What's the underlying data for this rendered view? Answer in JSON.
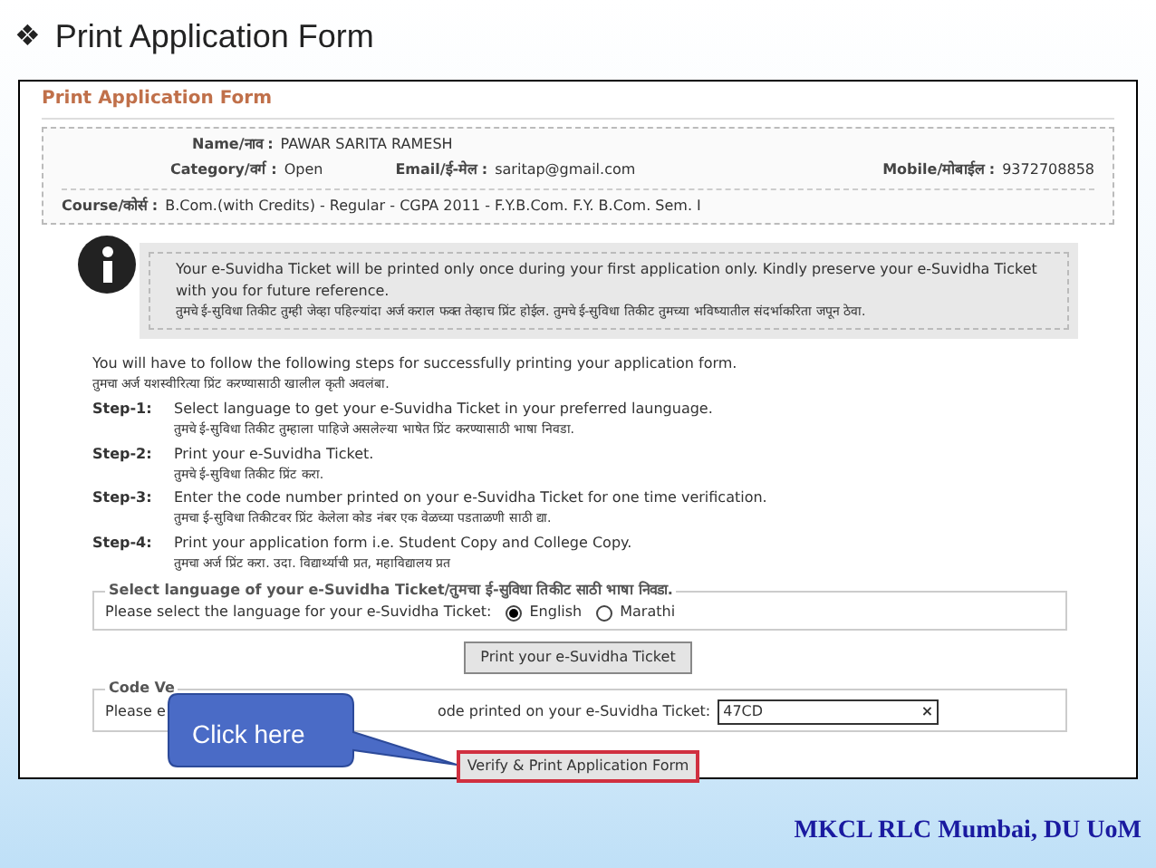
{
  "slide_title": {
    "bullet": "❖",
    "text": "Print Application Form"
  },
  "form": {
    "header": "Print Application Form",
    "user_info": {
      "name_label": "Name/नाव :",
      "name": "PAWAR SARITA RAMESH",
      "category_label": "Category/वर्ग :",
      "category": "Open",
      "email_label": "Email/ई-मेल :",
      "email": "saritap@gmail.com",
      "mobile_label": "Mobile/मोबाईल :",
      "mobile": "9372708858",
      "course_label": "Course/कोर्स :",
      "course": "B.Com.(with Credits) - Regular - CGPA 2011 - F.Y.B.Com. F.Y. B.Com. Sem. I"
    },
    "notice": {
      "english": "Your e-Suvidha Ticket will be printed only once during your first application only. Kindly preserve your e-Suvidha Ticket with you for future reference.",
      "marathi": "तुमचे ई-सुविधा तिकीट तुम्ही जेव्हा पहिल्यांदा अर्ज कराल फक्त तेव्हाच प्रिंट होईल. तुमचे ई-सुविधा तिकीट तुमच्या भविष्यातील संदर्भाकरिता जपून ठेवा."
    },
    "intro": {
      "english": "You will have to follow the following steps for successfully printing your application form.",
      "marathi": "तुमचा अर्ज यशस्वीरित्या प्रिंट करण्यासाठी खालील कृती अवलंबा."
    },
    "steps": [
      {
        "label": "Step-1:",
        "english": "Select language to get your e-Suvidha Ticket in your preferred launguage.",
        "marathi": "तुमचे ई-सुविधा तिकीट तुम्हाला पाहिजे असलेल्या भाषेत प्रिंट करण्यासाठी भाषा निवडा."
      },
      {
        "label": "Step-2:",
        "english": "Print your e-Suvidha Ticket.",
        "marathi": "तुमचे ई-सुविधा तिकीट प्रिंट करा."
      },
      {
        "label": "Step-3:",
        "english": "Enter the code number printed on your e-Suvidha Ticket for one time verification.",
        "marathi": "तुमचा ई-सुविधा तिकीटवर प्रिंट केलेला कोड नंबर एक वेळच्या पडताळणी साठी द्या."
      },
      {
        "label": "Step-4:",
        "english": "Print your application form i.e. Student Copy and College Copy.",
        "marathi": "तुमचा अर्ज प्रिंट करा. उदा. विद्यार्थ्याची प्रत, महाविद्यालय प्रत"
      }
    ],
    "language": {
      "legend": "Select language of your e-Suvidha Ticket/तुमचा ई-सुविधा तिकीट साठी भाषा निवडा.",
      "prompt": "Please select the language for your e-Suvidha Ticket:",
      "options": [
        {
          "label": "English",
          "selected": true
        },
        {
          "label": "Marathi",
          "selected": false
        }
      ]
    },
    "print_ticket_button": "Print your e-Suvidha Ticket",
    "code_verification": {
      "legend": "Code Ve",
      "prompt_start": "Please e",
      "prompt_end": "ode printed on your e-Suvidha Ticket:",
      "value": "47CD",
      "clear": "×"
    },
    "verify_button": "Verify & Print Application Form"
  },
  "callout": "Click here",
  "footer": "MKCL RLC Mumbai, DU UoM"
}
